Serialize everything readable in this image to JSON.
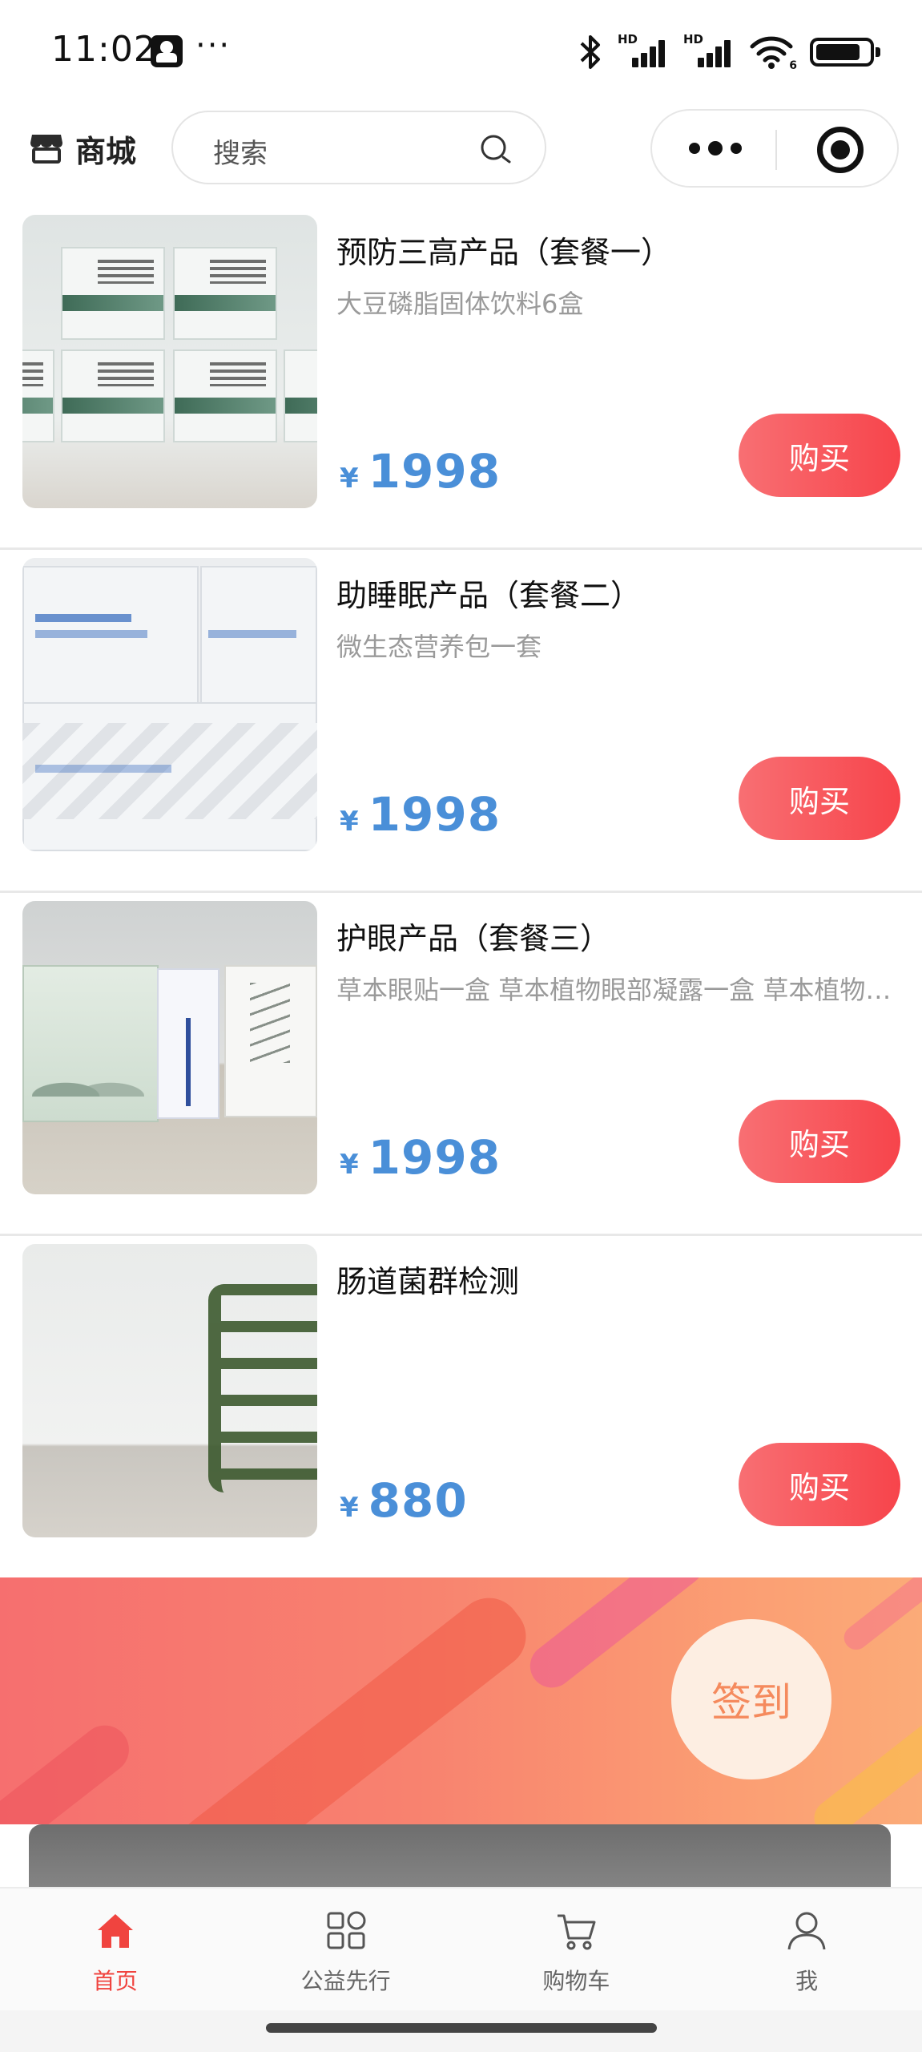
{
  "status_bar": {
    "time": "11:02",
    "more": "···",
    "signal_1_label": "HD",
    "signal_2_label": "HD",
    "wifi_label": "6",
    "battery_level": 0.85
  },
  "header": {
    "title": "商城",
    "search_placeholder": "搜索"
  },
  "products": [
    {
      "title": "预防三高产品（套餐一）",
      "desc": "大豆磷脂固体饮料6盒",
      "currency": "¥",
      "price": "1998",
      "buy_label": "购买"
    },
    {
      "title": "助睡眠产品（套餐二）",
      "desc": "微生态营养包一套",
      "currency": "¥",
      "price": "1998",
      "buy_label": "购买"
    },
    {
      "title": "护眼产品（套餐三）",
      "desc": "草本眼贴一盒 草本植物眼部凝露一盒 草本植物眼部凝露一盒",
      "currency": "¥",
      "price": "1998",
      "buy_label": "购买"
    },
    {
      "title": "肠道菌群检测",
      "desc": "",
      "currency": "¥",
      "price": "880",
      "buy_label": "购买"
    }
  ],
  "banner": {
    "sign_in_label": "签到"
  },
  "tabbar": {
    "items": [
      {
        "label": "首页",
        "icon": "home-icon",
        "active": true
      },
      {
        "label": "公益先行",
        "icon": "grid-apps-icon",
        "active": false
      },
      {
        "label": "购物车",
        "icon": "cart-icon",
        "active": false
      },
      {
        "label": "我",
        "icon": "user-icon",
        "active": false
      }
    ]
  },
  "colors": {
    "accent_red": "#f0443f",
    "price_blue": "#4a8fd8",
    "buy_button": "#f7444b",
    "banner_start": "#f66f6f",
    "banner_end": "#fbab78"
  }
}
